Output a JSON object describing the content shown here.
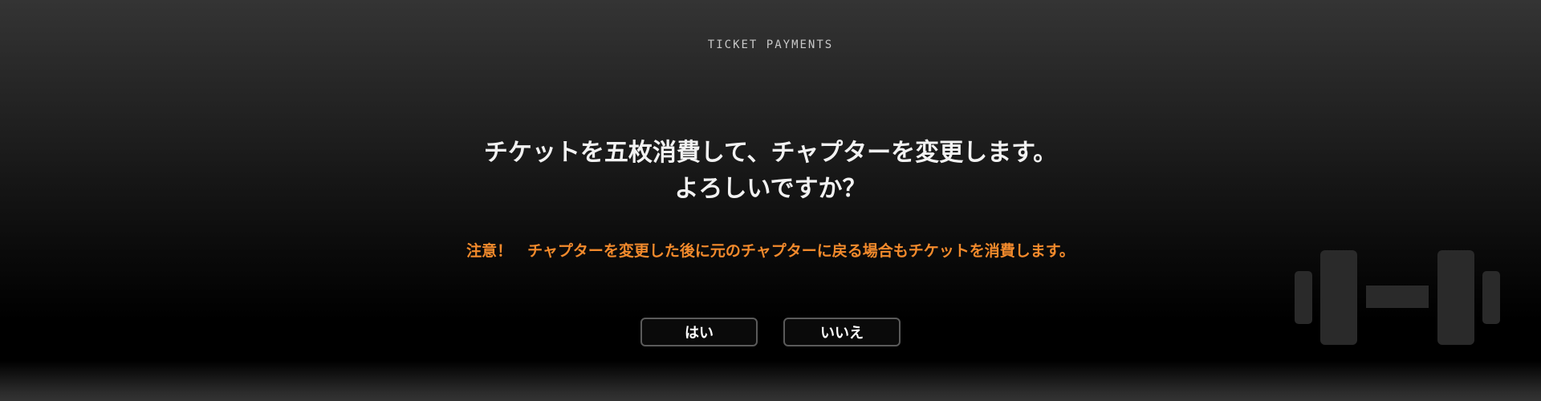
{
  "header": {
    "title": "TICKET PAYMENTS"
  },
  "dialog": {
    "message_line1": "チケットを五枚消費して、チャプターを変更します。",
    "message_line2": "よろしいですか？",
    "warning": "注意！　チャプターを変更した後に元のチャプターに戻る場合もチケットを消費します。",
    "confirm_label": "はい",
    "cancel_label": "いいえ"
  },
  "decoration": {
    "icon": "dumbbell-icon"
  },
  "colors": {
    "warning": "#f28a2c",
    "text": "#f2f2f2",
    "button_border": "#5a5a5a"
  }
}
